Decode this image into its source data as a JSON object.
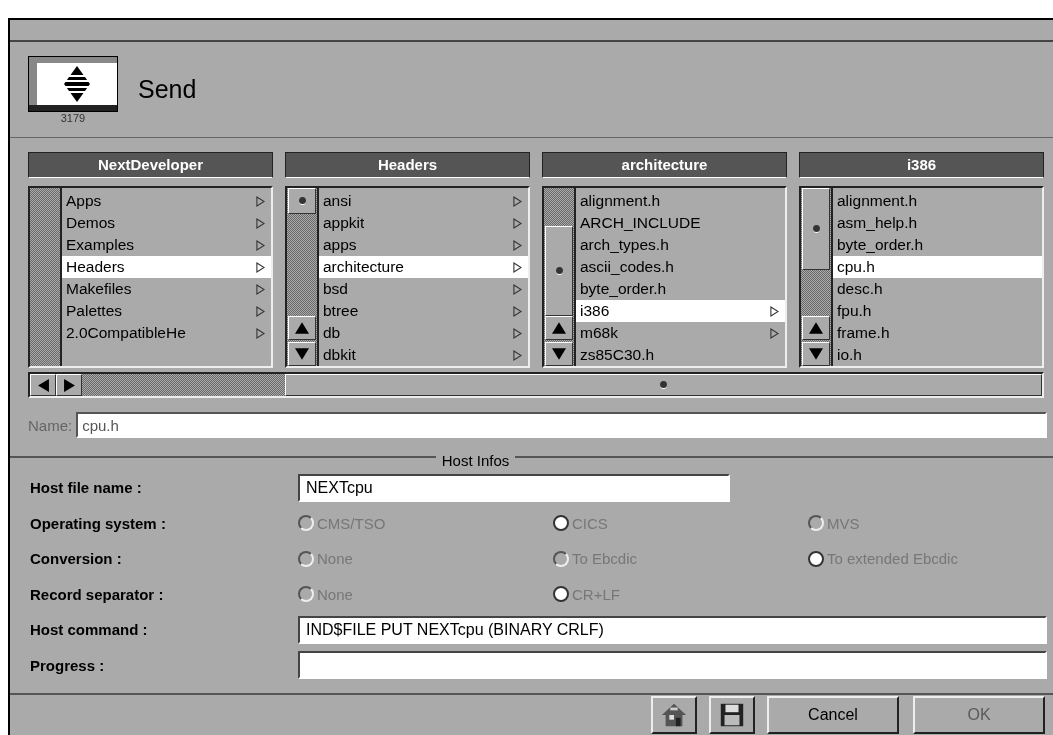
{
  "window": {
    "icon_label": "3179",
    "title": "Send"
  },
  "browser": {
    "columns": [
      {
        "title": "NextDeveloper",
        "items": [
          {
            "label": "Apps",
            "has_children": true,
            "selected": false
          },
          {
            "label": "Demos",
            "has_children": true,
            "selected": false
          },
          {
            "label": "Examples",
            "has_children": true,
            "selected": false
          },
          {
            "label": "Headers",
            "has_children": true,
            "selected": true
          },
          {
            "label": "Makefiles",
            "has_children": true,
            "selected": false
          },
          {
            "label": "Palettes",
            "has_children": true,
            "selected": false
          },
          {
            "label": "2.0CompatibleHe",
            "has_children": true,
            "selected": false
          }
        ]
      },
      {
        "title": "Headers",
        "items": [
          {
            "label": "ansi",
            "has_children": true,
            "selected": false
          },
          {
            "label": "appkit",
            "has_children": true,
            "selected": false
          },
          {
            "label": "apps",
            "has_children": true,
            "selected": false
          },
          {
            "label": "architecture",
            "has_children": true,
            "selected": true
          },
          {
            "label": "bsd",
            "has_children": true,
            "selected": false
          },
          {
            "label": "btree",
            "has_children": true,
            "selected": false
          },
          {
            "label": "db",
            "has_children": true,
            "selected": false
          },
          {
            "label": "dbkit",
            "has_children": true,
            "selected": false
          }
        ]
      },
      {
        "title": "architecture",
        "items": [
          {
            "label": "alignment.h",
            "has_children": false,
            "selected": false
          },
          {
            "label": "ARCH_INCLUDE",
            "has_children": false,
            "selected": false
          },
          {
            "label": "arch_types.h",
            "has_children": false,
            "selected": false
          },
          {
            "label": "ascii_codes.h",
            "has_children": false,
            "selected": false
          },
          {
            "label": "byte_order.h",
            "has_children": false,
            "selected": false
          },
          {
            "label": "i386",
            "has_children": true,
            "selected": true
          },
          {
            "label": "m68k",
            "has_children": true,
            "selected": false
          },
          {
            "label": "zs85C30.h",
            "has_children": false,
            "selected": false
          }
        ]
      },
      {
        "title": "i386",
        "items": [
          {
            "label": "alignment.h",
            "has_children": false,
            "selected": false
          },
          {
            "label": "asm_help.h",
            "has_children": false,
            "selected": false
          },
          {
            "label": "byte_order.h",
            "has_children": false,
            "selected": false
          },
          {
            "label": "cpu.h",
            "has_children": false,
            "selected": true
          },
          {
            "label": "desc.h",
            "has_children": false,
            "selected": false
          },
          {
            "label": "fpu.h",
            "has_children": false,
            "selected": false
          },
          {
            "label": "frame.h",
            "has_children": false,
            "selected": false
          },
          {
            "label": "io.h",
            "has_children": false,
            "selected": false
          }
        ]
      }
    ]
  },
  "name_field": {
    "label": "Name:",
    "value": "cpu.h"
  },
  "host_infos": {
    "title": "Host Infos",
    "rows": [
      {
        "kind": "short-field",
        "label": "Host file name :",
        "value": "NEXTcpu"
      },
      {
        "kind": "radio",
        "label": "Operating system :",
        "options": [
          {
            "label": "CMS/TSO",
            "selected": false
          },
          {
            "label": "CICS",
            "selected": true
          },
          {
            "label": "MVS",
            "selected": false
          }
        ]
      },
      {
        "kind": "radio",
        "label": "Conversion :",
        "options": [
          {
            "label": "None",
            "selected": false
          },
          {
            "label": "To Ebcdic",
            "selected": false
          },
          {
            "label": "To extended Ebcdic",
            "selected": true
          }
        ]
      },
      {
        "kind": "radio",
        "label": "Record separator :",
        "options": [
          {
            "label": "None",
            "selected": false
          },
          {
            "label": "CR+LF",
            "selected": true
          }
        ]
      },
      {
        "kind": "field",
        "label": "Host command :",
        "value": "IND$FILE PUT NEXTcpu (BINARY CRLF)"
      },
      {
        "kind": "field",
        "label": "Progress :",
        "value": ""
      }
    ]
  },
  "buttons": [
    {
      "label": "Cancel",
      "disabled": false
    },
    {
      "label": "OK",
      "disabled": true
    }
  ]
}
